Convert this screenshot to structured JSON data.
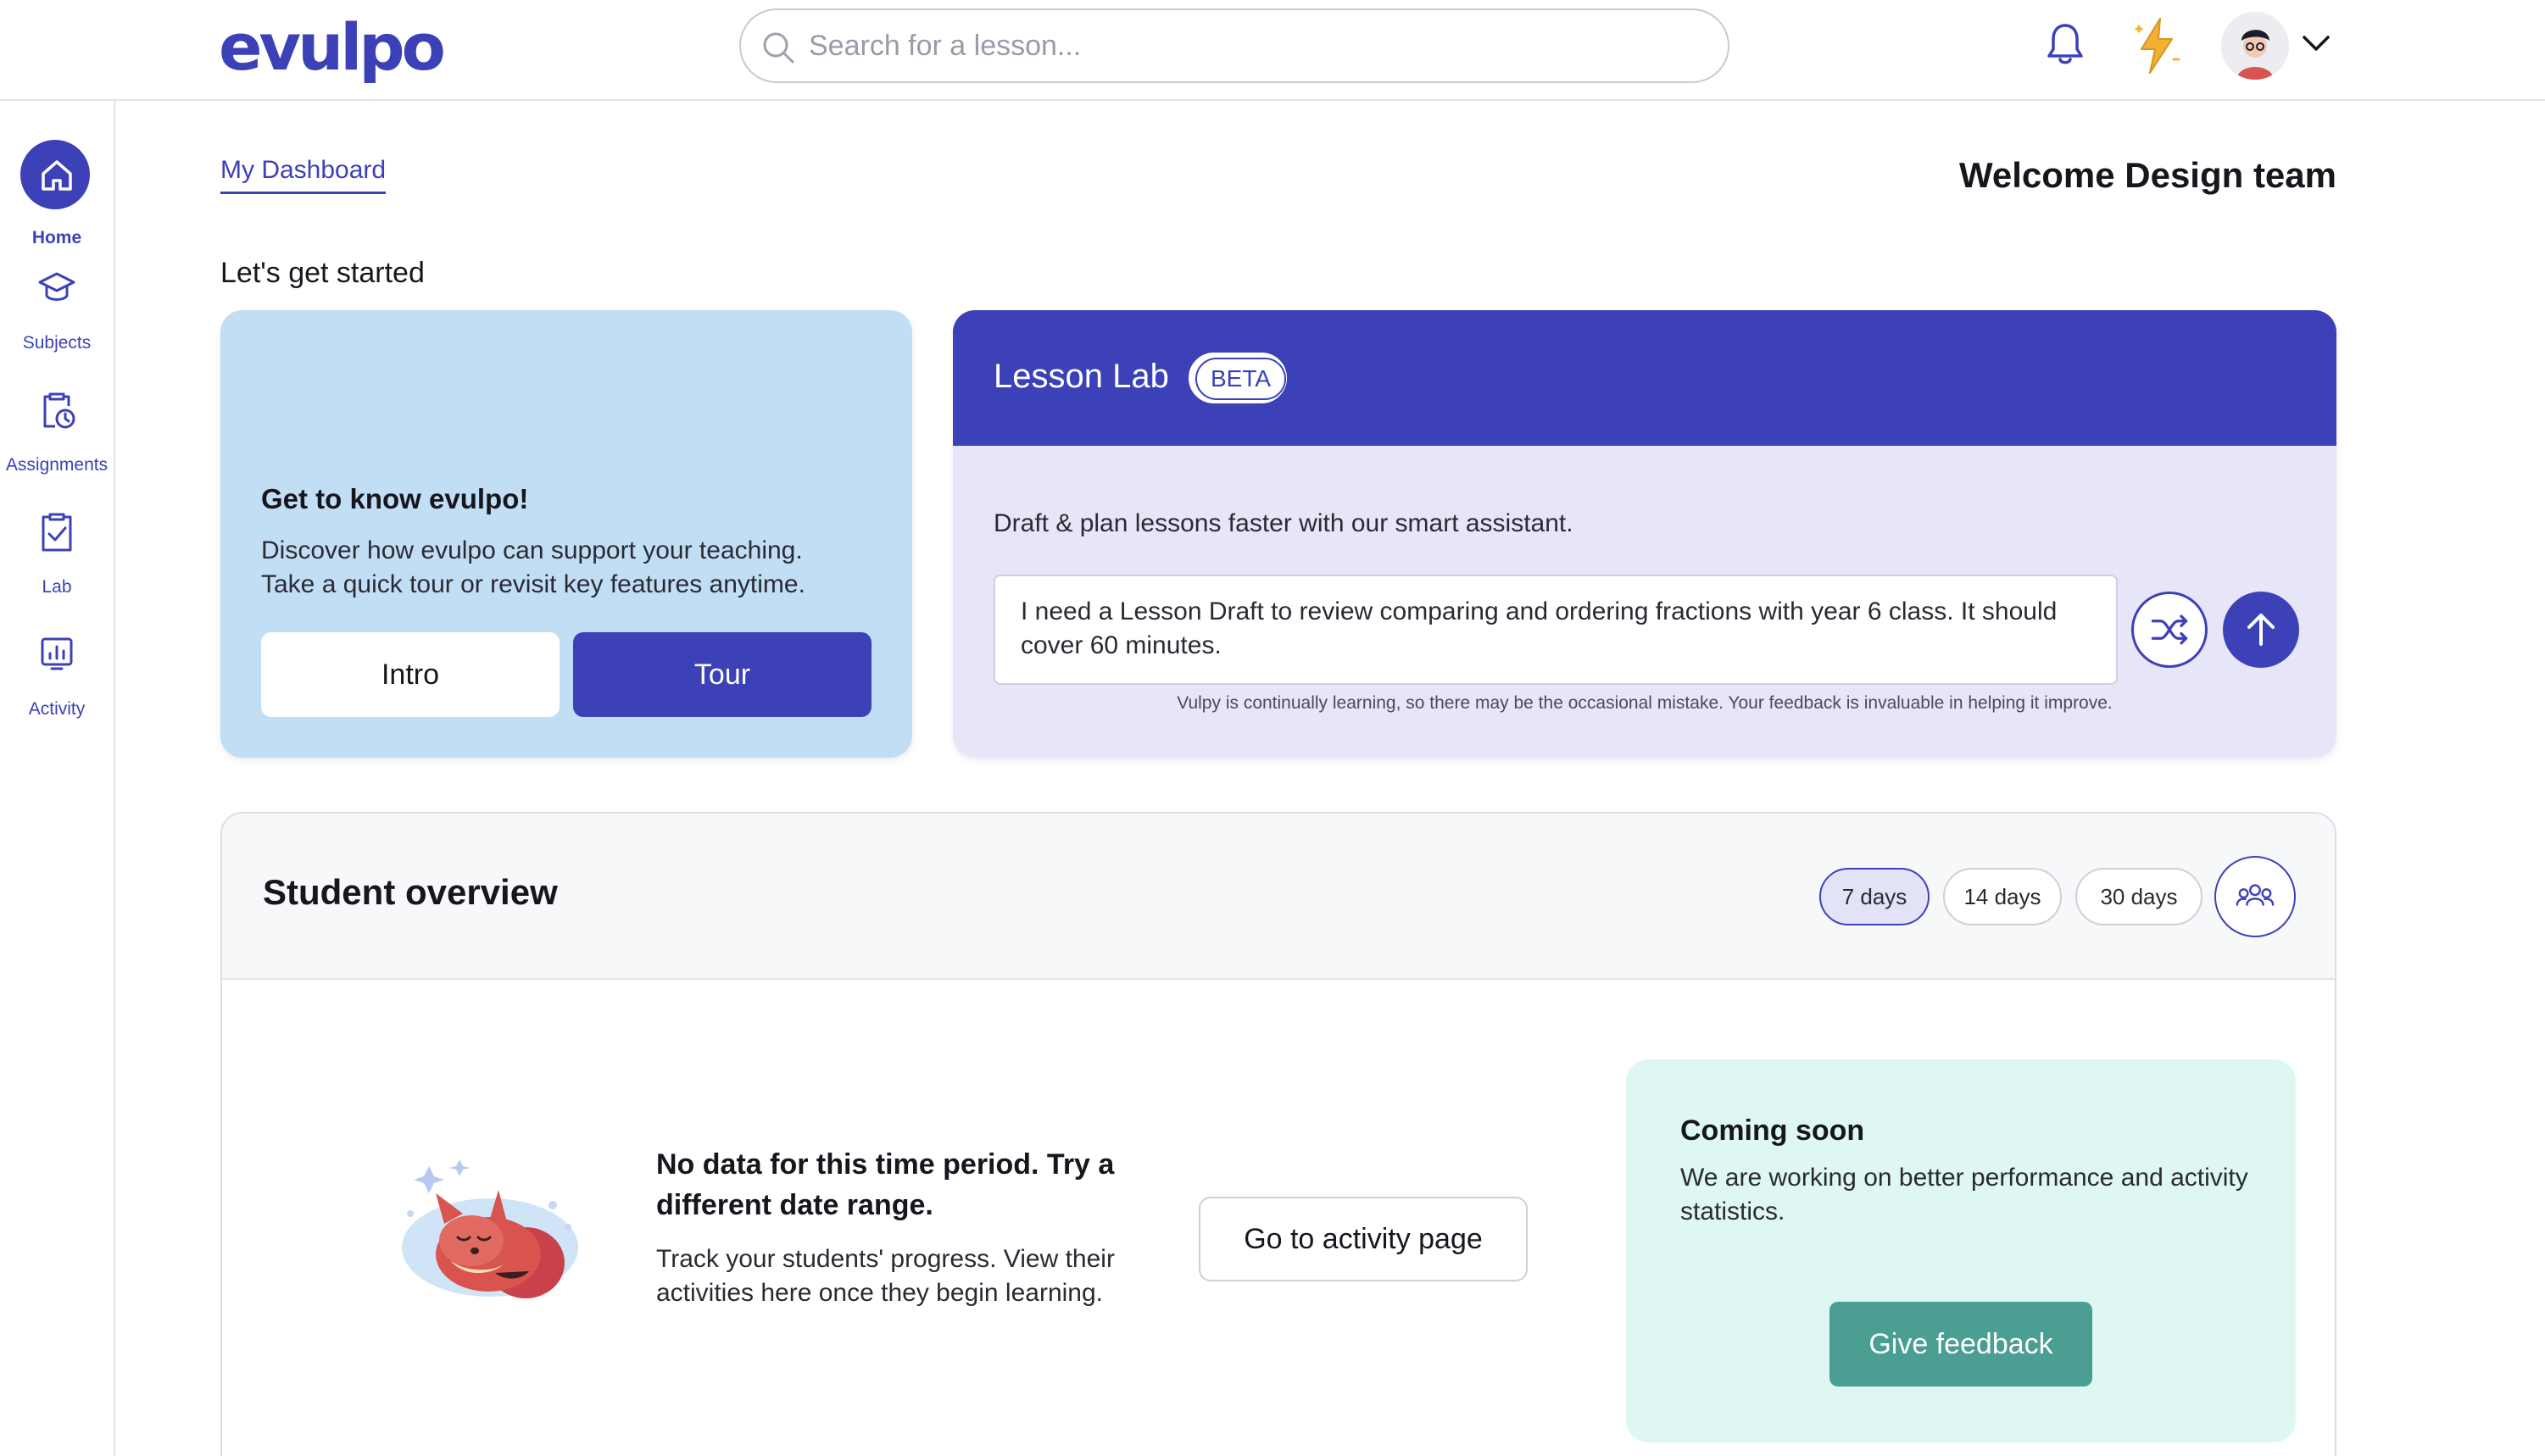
{
  "header": {
    "logo_text": "evulpo",
    "search": {
      "placeholder": "Search for a lesson...",
      "value": ""
    },
    "icons": [
      "bell-icon",
      "lightning-icon",
      "avatar",
      "chevron-down-icon"
    ]
  },
  "sidebar": {
    "items": [
      {
        "label": "Home",
        "icon": "home-icon",
        "active": true
      },
      {
        "label": "Subjects",
        "icon": "graduation-cap-icon"
      },
      {
        "label": "Assignments",
        "icon": "clipboard-clock-icon"
      },
      {
        "label": "Lab",
        "icon": "clipboard-check-icon"
      },
      {
        "label": "Activity",
        "icon": "chart-icon"
      }
    ]
  },
  "main": {
    "breadcrumb": "My Dashboard",
    "welcome": "Welcome Design team",
    "section_title": "Let's get started",
    "know_card": {
      "title": "Get to know evulpo!",
      "desc_line1": "Discover how evulpo can support your teaching.",
      "desc_line2": "Take a quick tour or revisit key features anytime.",
      "intro_label": "Intro",
      "tour_label": "Tour"
    },
    "lesson_lab": {
      "title": "Lesson Lab",
      "badge": "BETA",
      "desc": "Draft & plan lessons faster with our smart assistant.",
      "prompt_value": "I need a Lesson Draft to review comparing and ordering fractions with year 6 class. It should cover 60 minutes.",
      "note": "Vulpy is continually learning, so there may be the occasional mistake. Your feedback is invaluable in helping it improve."
    },
    "overview": {
      "title": "Student overview",
      "ranges": [
        {
          "label": "7 days",
          "active": true
        },
        {
          "label": "14 days"
        },
        {
          "label": "30 days"
        }
      ],
      "empty_title": "No data for this time period. Try a different date range.",
      "empty_desc": "Track your students' progress. View their activities here once they begin learning.",
      "activity_btn": "Go to activity page",
      "coming_soon": {
        "title": "Coming soon",
        "desc": "We are working on better performance and activity statistics.",
        "button": "Give feedback"
      }
    }
  },
  "colors": {
    "brand": "#3c41b8",
    "card_blue": "#c2def4",
    "card_lavender": "#e7e6f8",
    "card_mint": "#dff7f3",
    "feedback_teal": "#4a9e92"
  }
}
